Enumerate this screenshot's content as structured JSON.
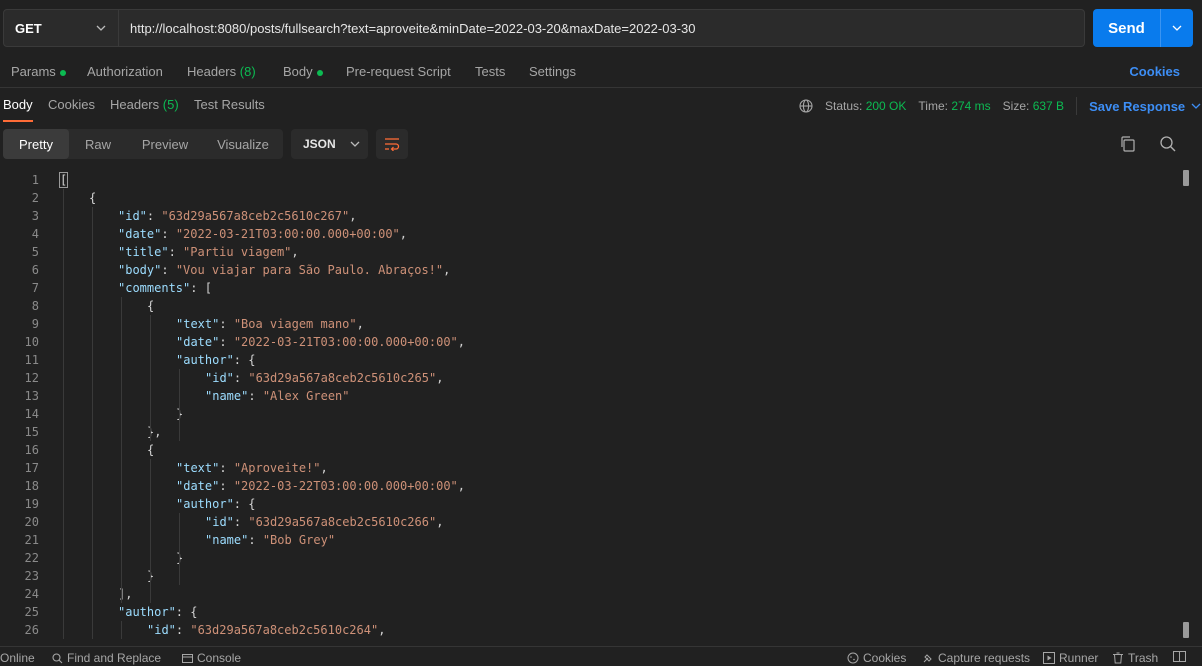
{
  "request": {
    "method": "GET",
    "url": "http://localhost:8080/posts/fullsearch?text=aproveite&minDate=2022-03-20&maxDate=2022-03-30",
    "send_label": "Send"
  },
  "request_tabs": {
    "params": "Params",
    "authorization": "Authorization",
    "headers": "Headers",
    "headers_count": "(8)",
    "body": "Body",
    "pre_request": "Pre-request Script",
    "tests": "Tests",
    "settings": "Settings",
    "cookies": "Cookies"
  },
  "response_tabs": {
    "body": "Body",
    "cookies": "Cookies",
    "headers": "Headers",
    "headers_count": "(5)",
    "test_results": "Test Results"
  },
  "response_meta": {
    "status_label": "Status:",
    "status_value": "200 OK",
    "time_label": "Time:",
    "time_value": "274 ms",
    "size_label": "Size:",
    "size_value": "637 B",
    "save_response": "Save Response"
  },
  "view_modes": [
    "Pretty",
    "Raw",
    "Preview",
    "Visualize"
  ],
  "format": "JSON",
  "code_lines": [
    {
      "n": "1",
      "indent": 0,
      "parts": [
        [
          "p",
          "["
        ]
      ]
    },
    {
      "n": "2",
      "indent": 1,
      "parts": [
        [
          "p",
          "{"
        ]
      ]
    },
    {
      "n": "3",
      "indent": 2,
      "parts": [
        [
          "k",
          "\"id\""
        ],
        [
          "p",
          ": "
        ],
        [
          "s",
          "\"63d29a567a8ceb2c5610c267\""
        ],
        [
          "p",
          ","
        ]
      ]
    },
    {
      "n": "4",
      "indent": 2,
      "parts": [
        [
          "k",
          "\"date\""
        ],
        [
          "p",
          ": "
        ],
        [
          "s",
          "\"2022-03-21T03:00:00.000+00:00\""
        ],
        [
          "p",
          ","
        ]
      ]
    },
    {
      "n": "5",
      "indent": 2,
      "parts": [
        [
          "k",
          "\"title\""
        ],
        [
          "p",
          ": "
        ],
        [
          "s",
          "\"Partiu viagem\""
        ],
        [
          "p",
          ","
        ]
      ]
    },
    {
      "n": "6",
      "indent": 2,
      "parts": [
        [
          "k",
          "\"body\""
        ],
        [
          "p",
          ": "
        ],
        [
          "s",
          "\"Vou viajar para São Paulo. Abraços!\""
        ],
        [
          "p",
          ","
        ]
      ]
    },
    {
      "n": "7",
      "indent": 2,
      "parts": [
        [
          "k",
          "\"comments\""
        ],
        [
          "p",
          ": ["
        ]
      ]
    },
    {
      "n": "8",
      "indent": 3,
      "parts": [
        [
          "p",
          "{"
        ]
      ]
    },
    {
      "n": "9",
      "indent": 4,
      "parts": [
        [
          "k",
          "\"text\""
        ],
        [
          "p",
          ": "
        ],
        [
          "s",
          "\"Boa viagem mano\""
        ],
        [
          "p",
          ","
        ]
      ]
    },
    {
      "n": "10",
      "indent": 4,
      "parts": [
        [
          "k",
          "\"date\""
        ],
        [
          "p",
          ": "
        ],
        [
          "s",
          "\"2022-03-21T03:00:00.000+00:00\""
        ],
        [
          "p",
          ","
        ]
      ]
    },
    {
      "n": "11",
      "indent": 4,
      "parts": [
        [
          "k",
          "\"author\""
        ],
        [
          "p",
          ": {"
        ]
      ]
    },
    {
      "n": "12",
      "indent": 5,
      "parts": [
        [
          "k",
          "\"id\""
        ],
        [
          "p",
          ": "
        ],
        [
          "s",
          "\"63d29a567a8ceb2c5610c265\""
        ],
        [
          "p",
          ","
        ]
      ]
    },
    {
      "n": "13",
      "indent": 5,
      "parts": [
        [
          "k",
          "\"name\""
        ],
        [
          "p",
          ": "
        ],
        [
          "s",
          "\"Alex Green\""
        ]
      ]
    },
    {
      "n": "14",
      "indent": 4,
      "parts": [
        [
          "p",
          "}"
        ]
      ]
    },
    {
      "n": "15",
      "indent": 3,
      "parts": [
        [
          "p",
          "},"
        ]
      ]
    },
    {
      "n": "16",
      "indent": 3,
      "parts": [
        [
          "p",
          "{"
        ]
      ]
    },
    {
      "n": "17",
      "indent": 4,
      "parts": [
        [
          "k",
          "\"text\""
        ],
        [
          "p",
          ": "
        ],
        [
          "s",
          "\"Aproveite!\""
        ],
        [
          "p",
          ","
        ]
      ]
    },
    {
      "n": "18",
      "indent": 4,
      "parts": [
        [
          "k",
          "\"date\""
        ],
        [
          "p",
          ": "
        ],
        [
          "s",
          "\"2022-03-22T03:00:00.000+00:00\""
        ],
        [
          "p",
          ","
        ]
      ]
    },
    {
      "n": "19",
      "indent": 4,
      "parts": [
        [
          "k",
          "\"author\""
        ],
        [
          "p",
          ": {"
        ]
      ]
    },
    {
      "n": "20",
      "indent": 5,
      "parts": [
        [
          "k",
          "\"id\""
        ],
        [
          "p",
          ": "
        ],
        [
          "s",
          "\"63d29a567a8ceb2c5610c266\""
        ],
        [
          "p",
          ","
        ]
      ]
    },
    {
      "n": "21",
      "indent": 5,
      "parts": [
        [
          "k",
          "\"name\""
        ],
        [
          "p",
          ": "
        ],
        [
          "s",
          "\"Bob Grey\""
        ]
      ]
    },
    {
      "n": "22",
      "indent": 4,
      "parts": [
        [
          "p",
          "}"
        ]
      ]
    },
    {
      "n": "23",
      "indent": 3,
      "parts": [
        [
          "p",
          "}"
        ]
      ]
    },
    {
      "n": "24",
      "indent": 2,
      "parts": [
        [
          "p",
          "],"
        ]
      ]
    },
    {
      "n": "25",
      "indent": 2,
      "parts": [
        [
          "k",
          "\"author\""
        ],
        [
          "p",
          ": {"
        ]
      ]
    },
    {
      "n": "26",
      "indent": 3,
      "parts": [
        [
          "k",
          "\"id\""
        ],
        [
          "p",
          ": "
        ],
        [
          "s",
          "\"63d29a567a8ceb2c5610c264\""
        ],
        [
          "p",
          ","
        ]
      ]
    }
  ],
  "statusbar": {
    "online": "Online",
    "find_replace": "Find and Replace",
    "console": "Console",
    "cookies": "Cookies",
    "capture": "Capture requests",
    "runner": "Runner",
    "trash": "Trash"
  },
  "colors": {
    "accent_orange": "#ff6c37",
    "send_blue": "#097bed",
    "link_blue": "#3d8ef5",
    "success_green": "#0cbb52",
    "json_key": "#9cdcfe",
    "json_string": "#ce9178"
  }
}
